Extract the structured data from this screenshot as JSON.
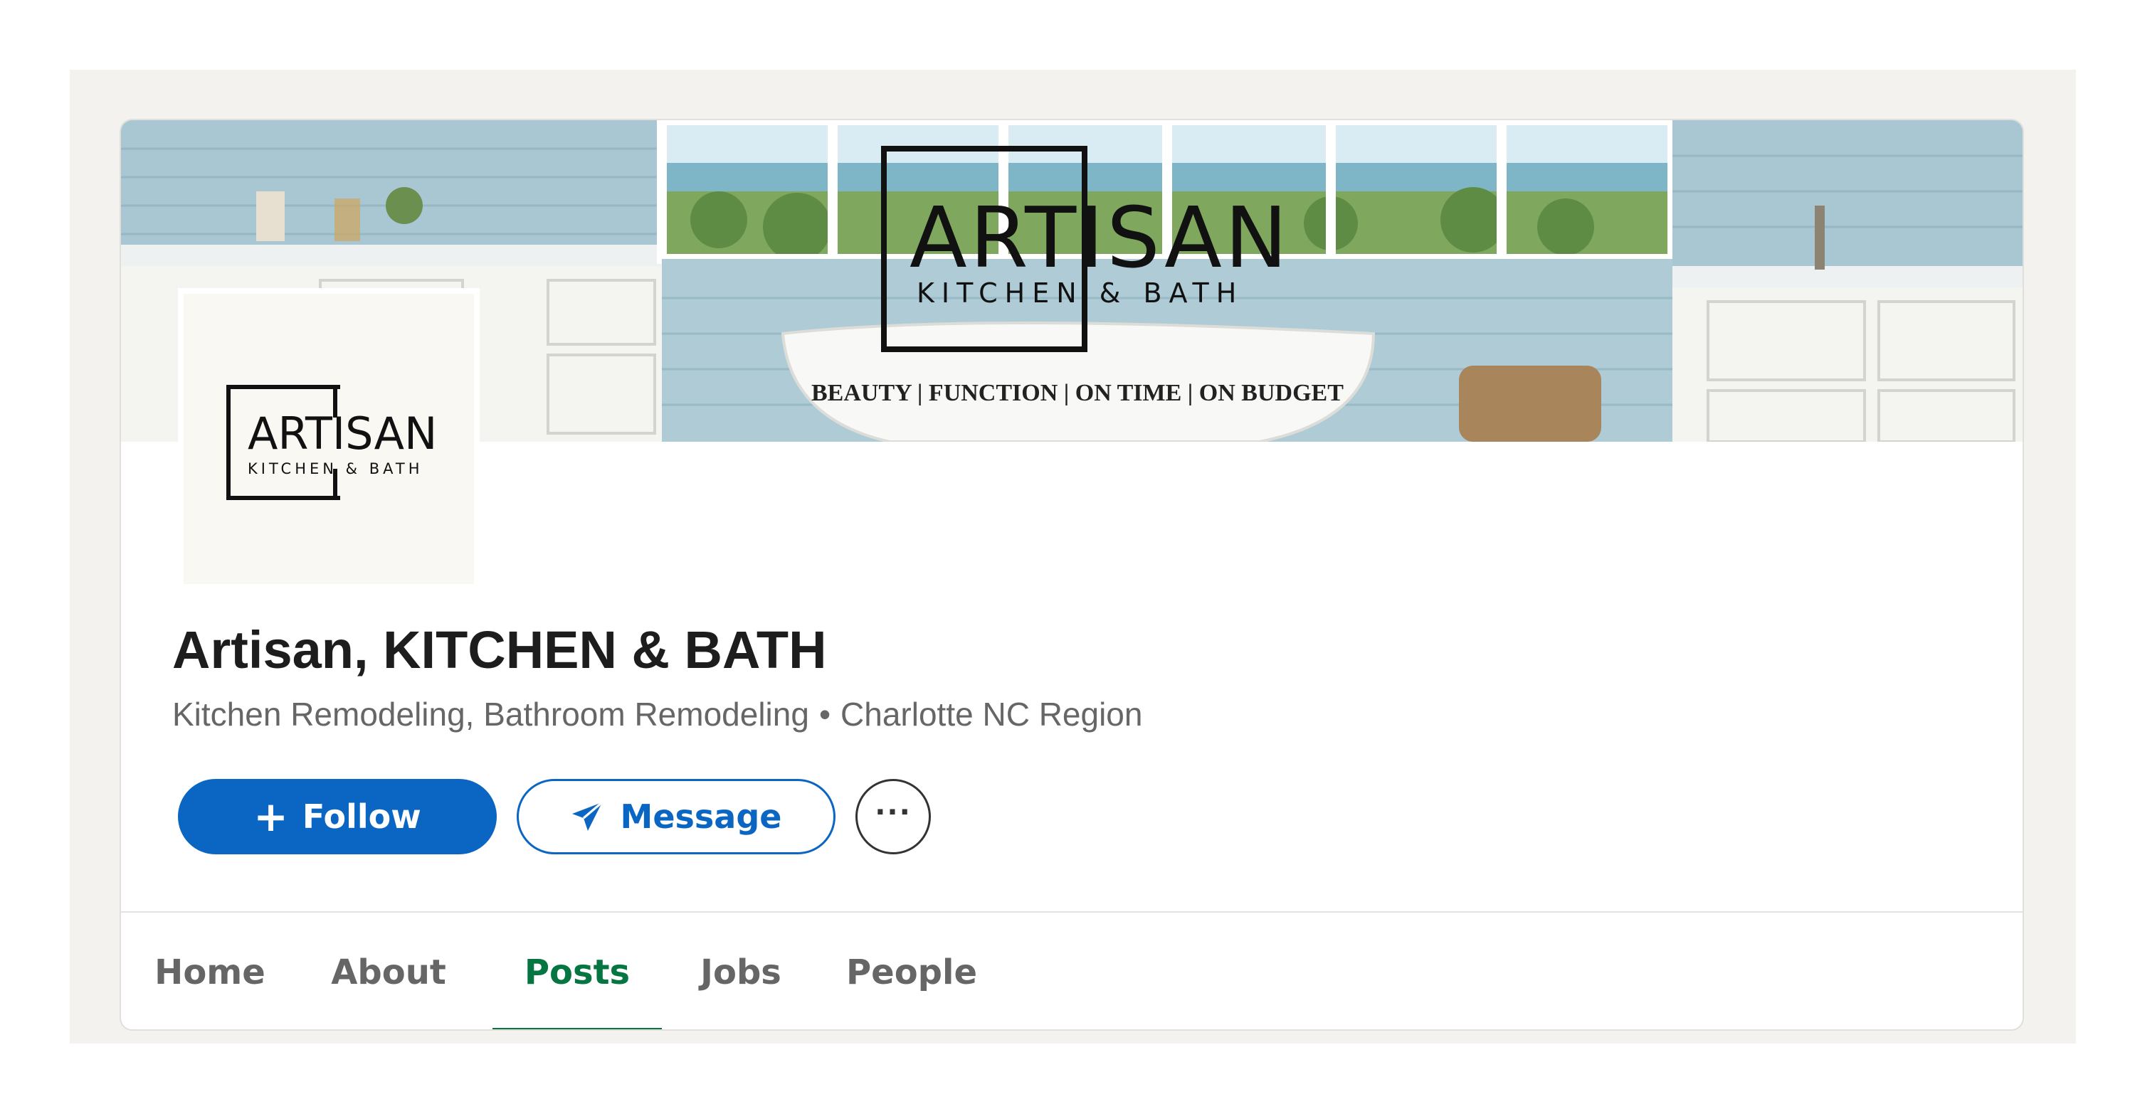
{
  "banner": {
    "brand_name": "ARTISAN",
    "brand_sub": "KITCHEN & BATH",
    "tagline": "BEAUTY | FUNCTION | ON TIME | ON BUDGET"
  },
  "avatar": {
    "brand_name": "ARTISAN",
    "brand_sub": "KITCHEN & BATH"
  },
  "company": {
    "name": "Artisan, KITCHEN & BATH",
    "industry": "Kitchen Remodeling, Bathroom Remodeling",
    "separator": "•",
    "location": "Charlotte NC Region"
  },
  "actions": {
    "follow_icon": "+",
    "follow_label": "Follow",
    "message_label": "Message",
    "more_label": "···"
  },
  "tabs": [
    {
      "label": "Home",
      "active": false
    },
    {
      "label": "About",
      "active": false
    },
    {
      "label": "Posts",
      "active": true
    },
    {
      "label": "Jobs",
      "active": false
    },
    {
      "label": "People",
      "active": false
    }
  ],
  "colors": {
    "primary": "#0a66c2",
    "active_tab": "#057642",
    "page_bg": "#f3f2ef"
  },
  "icons": {
    "follow": "plus-icon",
    "message": "send-icon",
    "more": "more-icon"
  }
}
